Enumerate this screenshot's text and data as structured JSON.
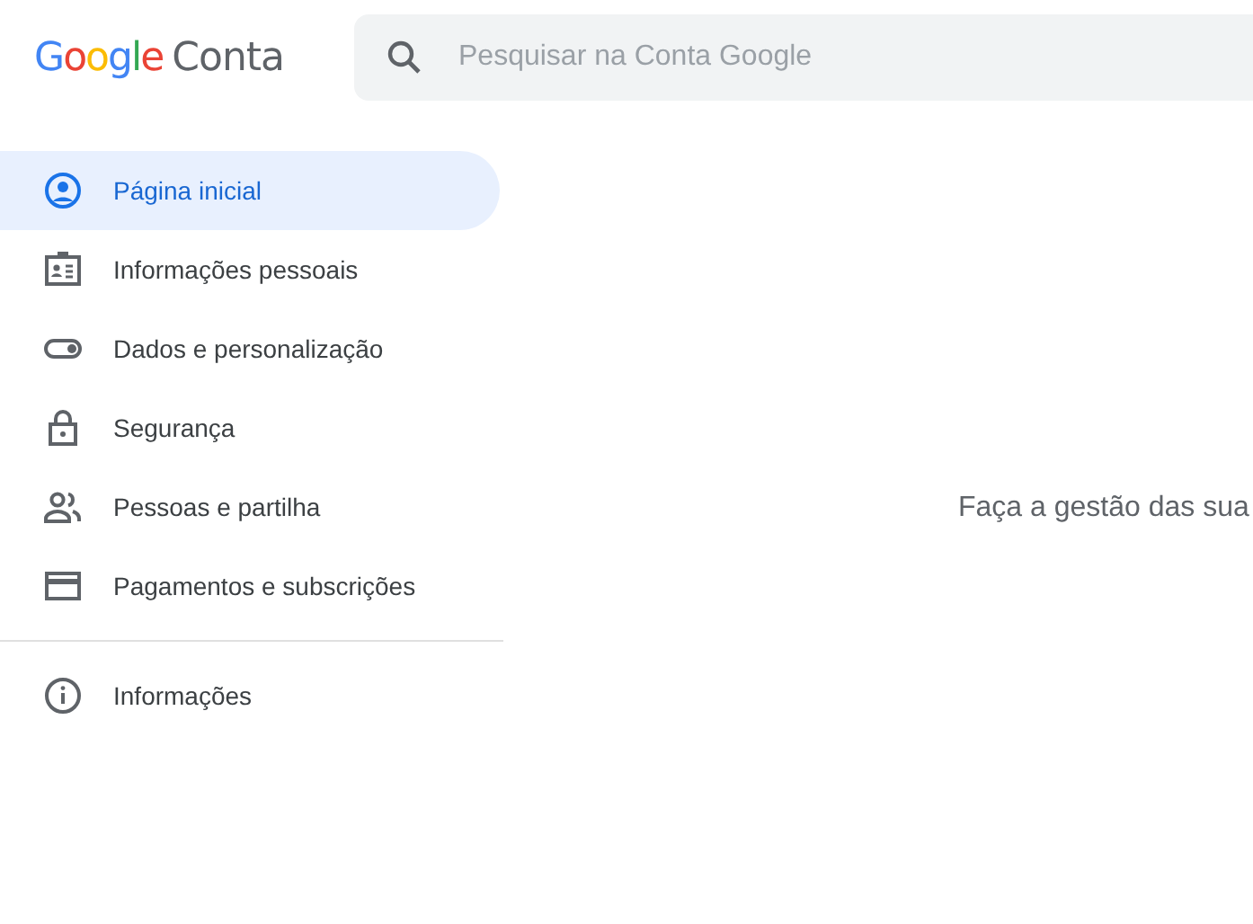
{
  "header": {
    "logo": "Google",
    "product": "Conta",
    "search": {
      "placeholder": "Pesquisar na Conta Google"
    }
  },
  "sidebar": {
    "items": [
      {
        "label": "Página inicial",
        "kind": "home",
        "selected": true
      },
      {
        "label": "Informações pessoais",
        "kind": "id-card",
        "selected": false
      },
      {
        "label": "Dados e personalização",
        "kind": "toggle",
        "selected": false
      },
      {
        "label": "Segurança",
        "kind": "lock",
        "selected": false
      },
      {
        "label": "Pessoas e partilha",
        "kind": "people",
        "selected": false
      },
      {
        "label": "Pagamentos e subscrições",
        "kind": "card",
        "selected": false
      }
    ],
    "secondary": [
      {
        "label": "Informações",
        "kind": "info",
        "selected": false
      }
    ]
  },
  "main": {
    "subtitle": "Faça a gestão das sua"
  }
}
